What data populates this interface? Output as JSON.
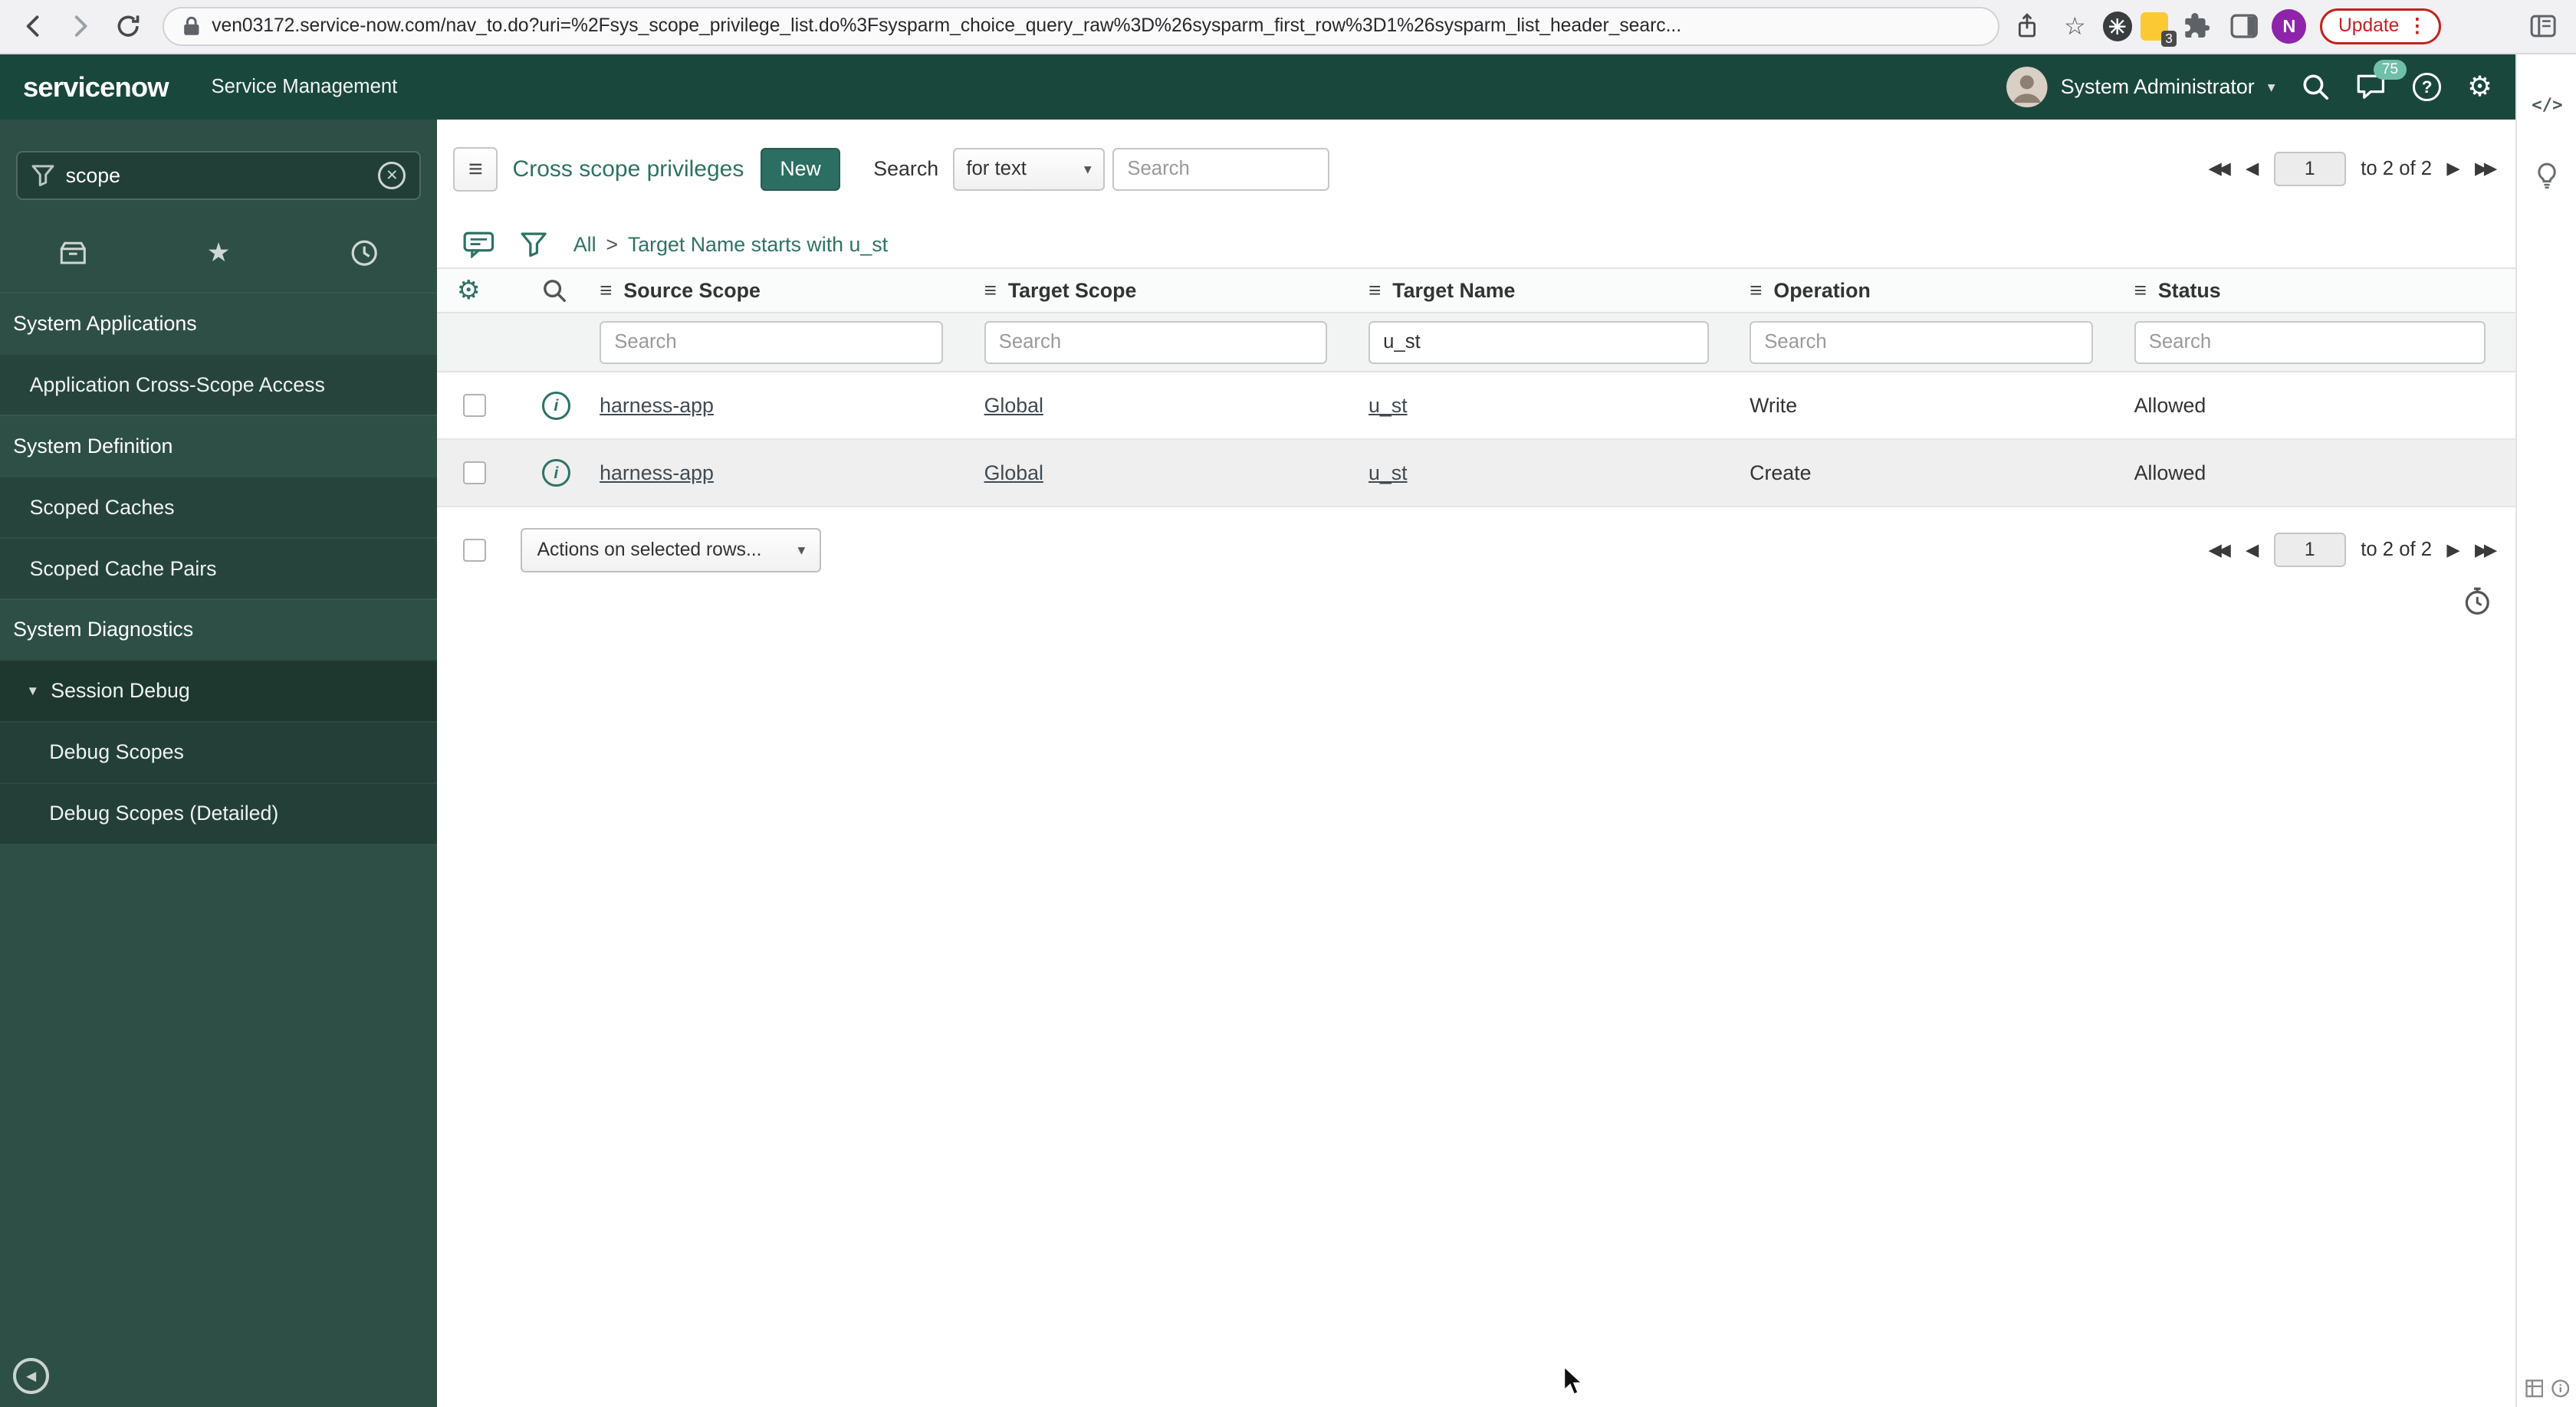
{
  "colors": {
    "accent": "#2f7265",
    "header_bg": "#1a473c",
    "sidebar_bg": "#2e4f45",
    "sidebar_item_bg": "#27443c",
    "sidebar_subitem_bg": "#233f38",
    "sidebar_selected_bg": "#1e3830",
    "primary_button_bg": "#2d6e62",
    "update_red": "#c5221f",
    "badge_teal": "#70bfa9",
    "avatar_purple": "#8e24aa",
    "extension_yellow": "#fbc934",
    "row_alt_bg": "#efefef"
  },
  "browser": {
    "url": "ven03172.service-now.com/nav_to.do?uri=%2Fsys_scope_privilege_list.do%3Fsysparm_choice_query_raw%3D%26sysparm_first_row%3D1%26sysparm_list_header_searc...",
    "update_label": "Update",
    "profile_initial": "N",
    "extension_badge": "3"
  },
  "header": {
    "logo": "servicenow",
    "product": "Service Management",
    "user": "System Administrator",
    "notification_count": "75"
  },
  "right_panel": {
    "code_glyph": "</>"
  },
  "sidebar": {
    "filter_value": "scope",
    "items": [
      {
        "label": "System Applications",
        "type": "section"
      },
      {
        "label": "Application Cross-Scope Access",
        "type": "module"
      },
      {
        "label": "System Definition",
        "type": "section"
      },
      {
        "label": "Scoped Caches",
        "type": "module"
      },
      {
        "label": "Scoped Cache Pairs",
        "type": "module"
      },
      {
        "label": "System Diagnostics",
        "type": "section"
      },
      {
        "label": "Session Debug",
        "type": "module-expanded"
      },
      {
        "label": "Debug Scopes",
        "type": "submodule"
      },
      {
        "label": "Debug Scopes (Detailed)",
        "type": "submodule"
      }
    ]
  },
  "list": {
    "title": "Cross scope privileges",
    "new_button": "New",
    "search_label": "Search",
    "search_type": "for text",
    "search_placeholder": "Search",
    "breadcrumb": {
      "root": "All",
      "separator": ">",
      "current": "Target Name starts with u_st"
    },
    "pagination": {
      "page": "1",
      "range_label": "to 2 of 2"
    },
    "actions_placeholder": "Actions on selected rows..."
  },
  "table": {
    "columns": [
      "Source Scope",
      "Target Scope",
      "Target Name",
      "Operation",
      "Status"
    ],
    "filter_placeholder": "Search",
    "filters": {
      "source_scope": "",
      "target_scope": "",
      "target_name": "u_st",
      "operation": "",
      "status": ""
    },
    "rows": [
      {
        "source_scope": "harness-app",
        "target_scope": "Global",
        "target_name": "u_st",
        "operation": "Write",
        "status": "Allowed"
      },
      {
        "source_scope": "harness-app",
        "target_scope": "Global",
        "target_name": "u_st",
        "operation": "Create",
        "status": "Allowed"
      }
    ]
  }
}
